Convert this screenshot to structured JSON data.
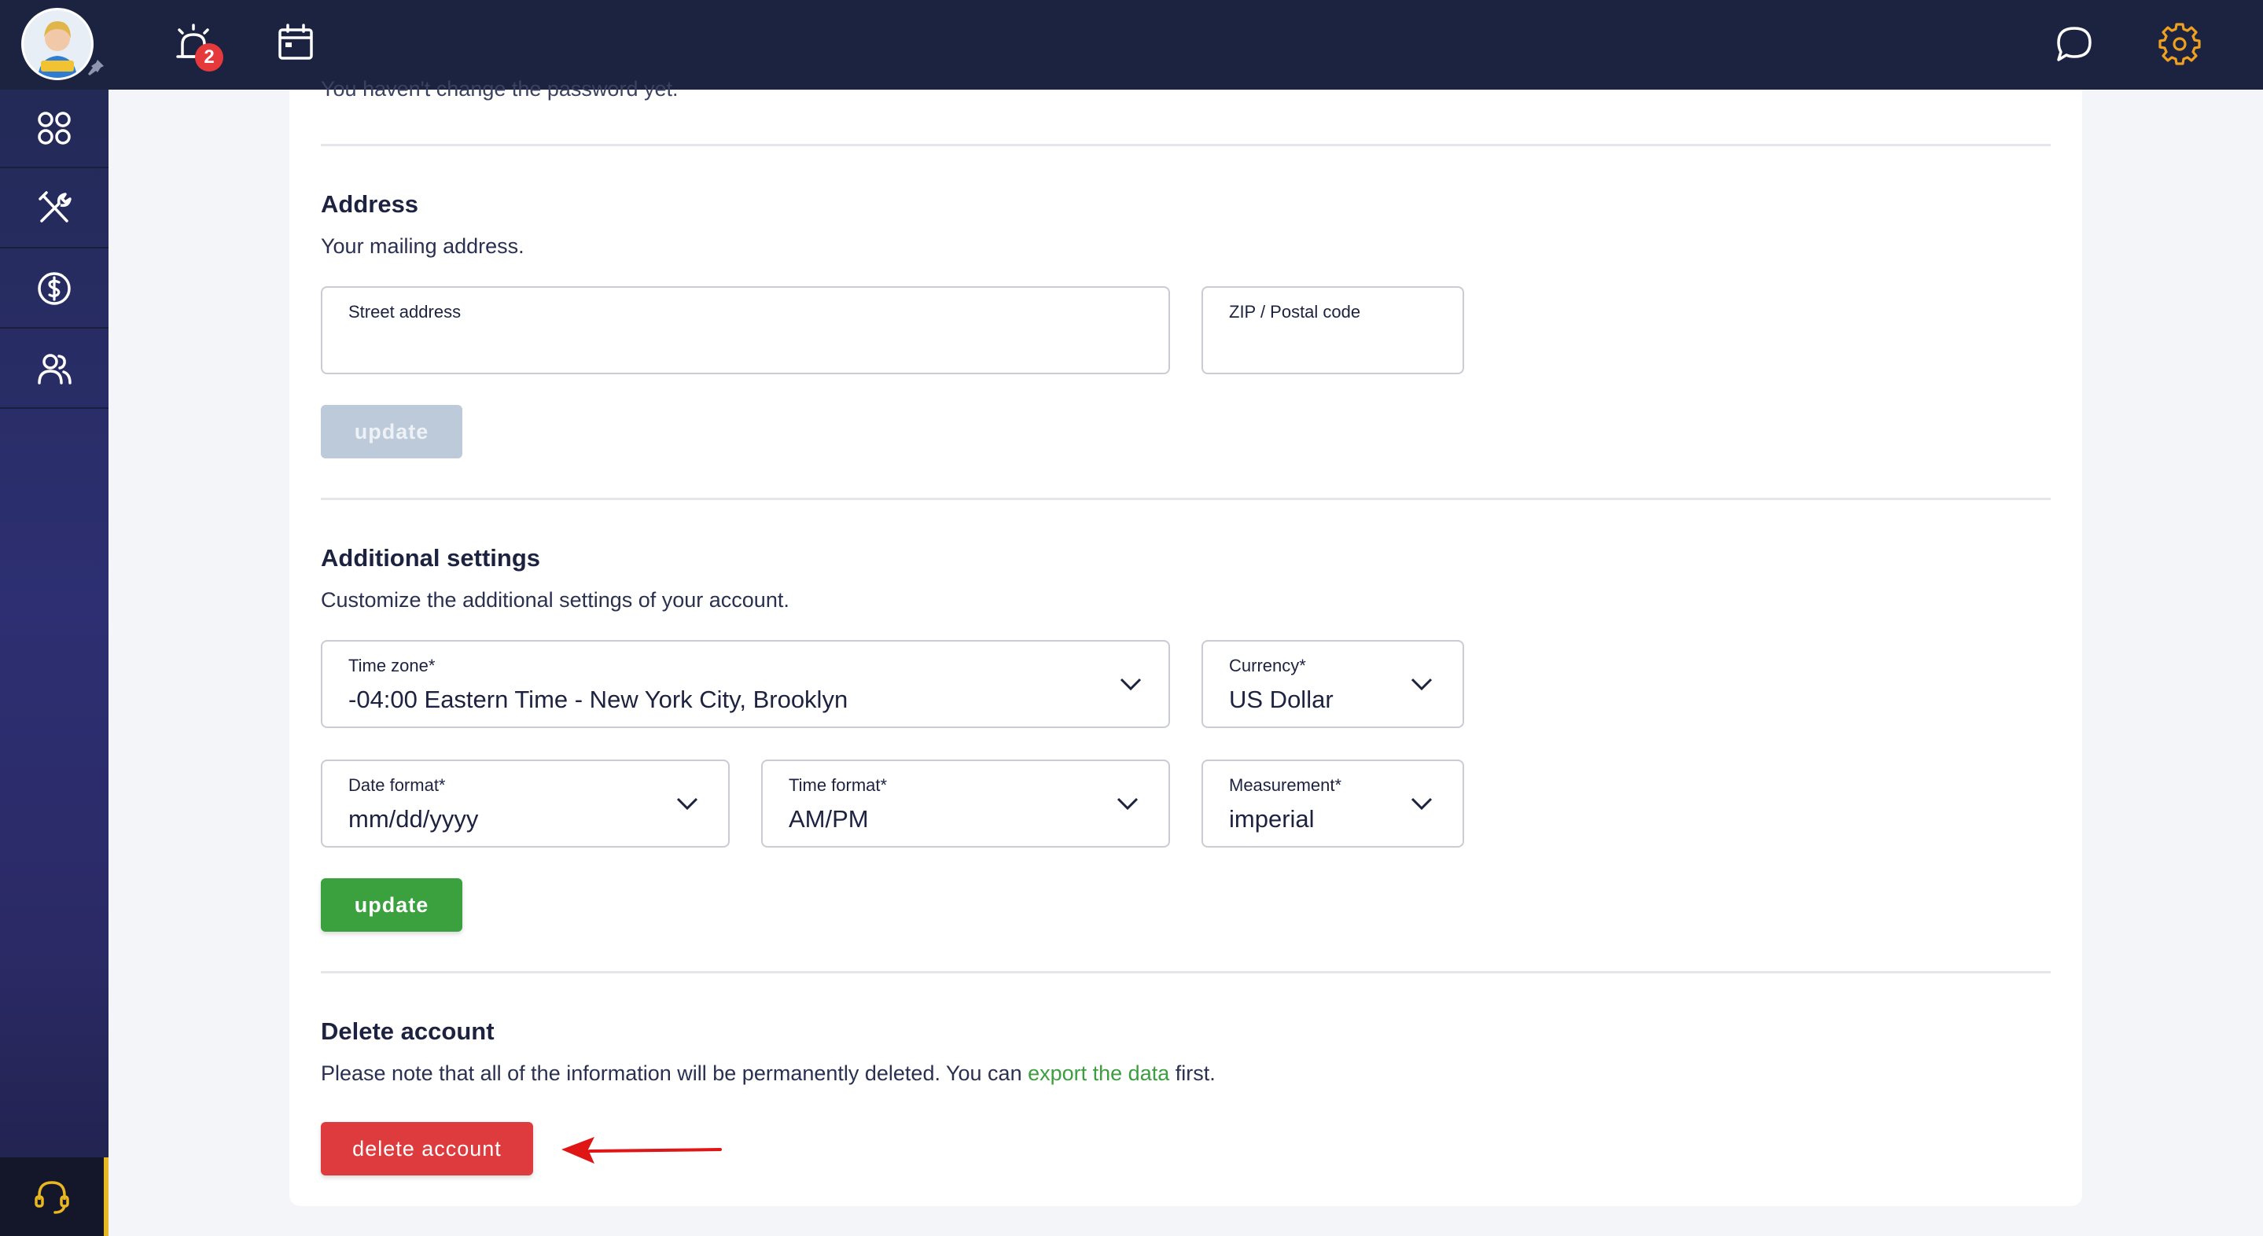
{
  "topbar": {
    "notification_count": "2"
  },
  "password_section": {
    "text": "You haven't change the password yet."
  },
  "address": {
    "title": "Address",
    "description": "Your mailing address.",
    "street_label": "Street address",
    "street_value": "",
    "zip_label": "ZIP / Postal code",
    "zip_value": "",
    "update_label": "update"
  },
  "additional": {
    "title": "Additional settings",
    "description": "Customize the additional settings of your account.",
    "timezone_label": "Time zone*",
    "timezone_value": "-04:00 Eastern Time - New York City, Brooklyn",
    "currency_label": "Currency*",
    "currency_value": "US Dollar",
    "date_format_label": "Date format*",
    "date_format_value": "mm/dd/yyyy",
    "time_format_label": "Time format*",
    "time_format_value": "AM/PM",
    "measurement_label": "Measurement*",
    "measurement_value": "imperial",
    "update_label": "update"
  },
  "delete_account": {
    "title": "Delete account",
    "description_before": "Please note that all of the information will be permanently deleted. You can ",
    "link_text": "export the data",
    "description_after": " first.",
    "button_label": "delete account"
  },
  "colors": {
    "topbar": "#1c2340",
    "accent_green": "#3aa13e",
    "danger_red": "#dd3b3e",
    "settings_orange": "#f0a020",
    "support_yellow": "#e8b722"
  }
}
